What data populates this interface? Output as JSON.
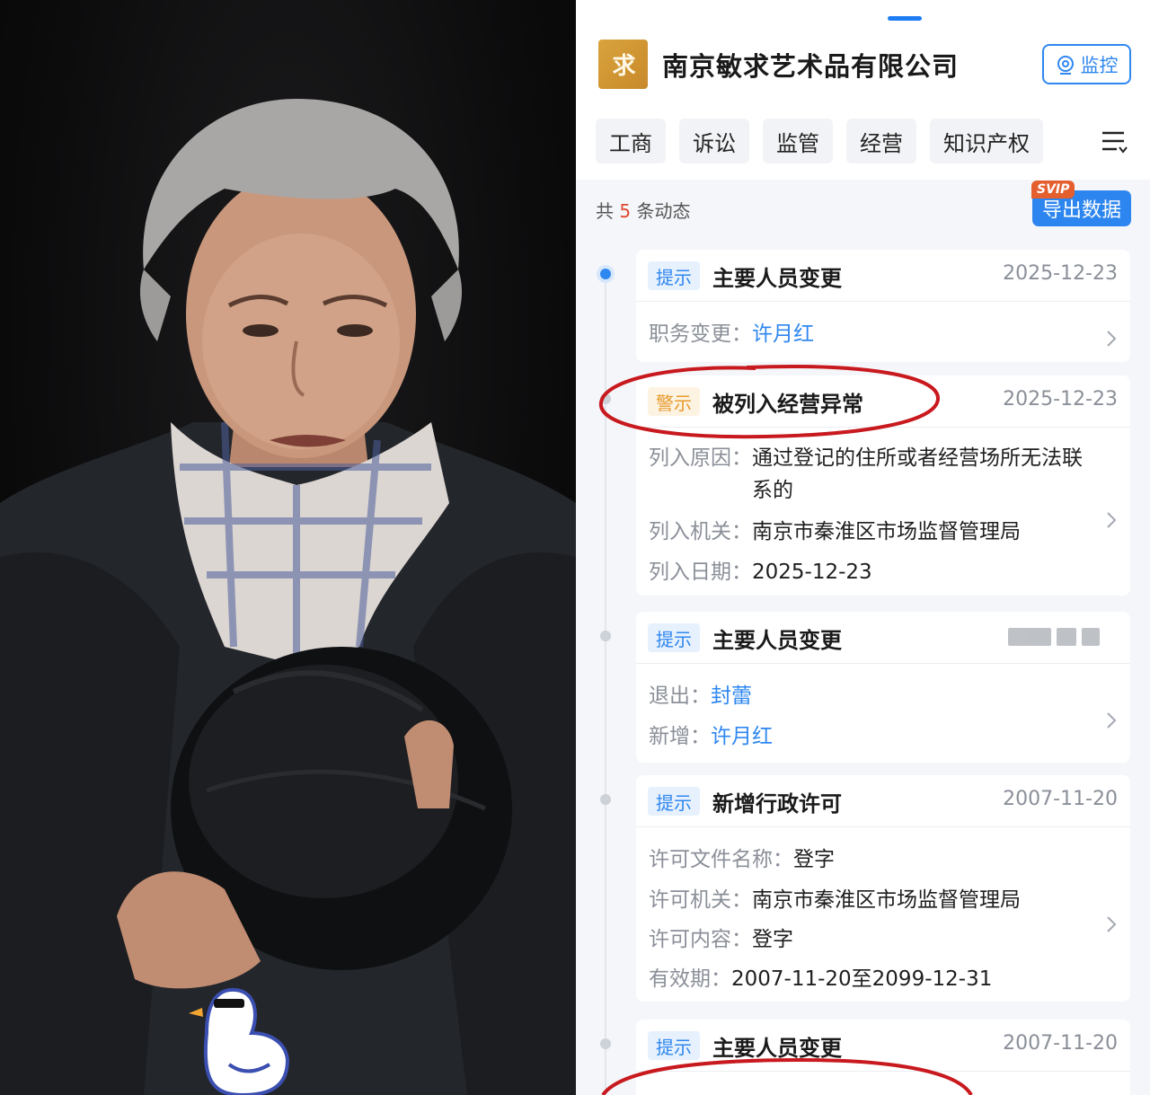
{
  "app": {
    "company_name": "南京敏求艺术品有限公司",
    "monitor_label": "监控",
    "tabs": [
      "工商",
      "诉讼",
      "监管",
      "经营",
      "知识产权"
    ],
    "summary_prefix": "共",
    "summary_count": "5",
    "summary_suffix": "条动态",
    "export_label": "导出数据",
    "svip_label": "SVIP"
  },
  "events": [
    {
      "badge": "提示",
      "title": "主要人员变更",
      "date": "2025-12-23",
      "rows": [
        {
          "label": "职务变更：",
          "value": "许月红"
        }
      ]
    },
    {
      "badge": "警示",
      "title": "被列入经营异常",
      "date": "2025-12-23",
      "rows": [
        {
          "label": "列入原因：",
          "value": "通过登记的住所或者经营场所无法联系的"
        },
        {
          "label": "列入机关：",
          "value": "南京市秦淮区市场监督管理局"
        },
        {
          "label": "列入日期：",
          "value": "2025-12-23"
        }
      ]
    },
    {
      "badge": "提示",
      "title": "主要人员变更",
      "date": "",
      "rows": [
        {
          "label": "退出：",
          "value": "封蕾"
        },
        {
          "label": "新增：",
          "value": "许月红"
        }
      ]
    },
    {
      "badge": "提示",
      "title": "新增行政许可",
      "date": "2007-11-20",
      "rows": [
        {
          "label": "许可文件名称：",
          "value": "登字"
        },
        {
          "label": "许可机关：",
          "value": "南京市秦淮区市场监督管理局"
        },
        {
          "label": "许可内容：",
          "value": "登字"
        },
        {
          "label": "有效期：",
          "value": "2007-11-20至2099-12-31"
        }
      ]
    },
    {
      "badge": "提示",
      "title": "主要人员变更",
      "date": "2007-11-20",
      "rows": []
    }
  ],
  "colors": {
    "accent": "#2f87f0",
    "warn": "#e89a2c",
    "count": "#e0492f",
    "annotation": "#c8191e"
  },
  "icons": {
    "monitor": "webcam-icon",
    "menu": "filter-menu-icon",
    "row_more": "chevron-right-icon",
    "sticker": "duck-sticker-icon"
  }
}
